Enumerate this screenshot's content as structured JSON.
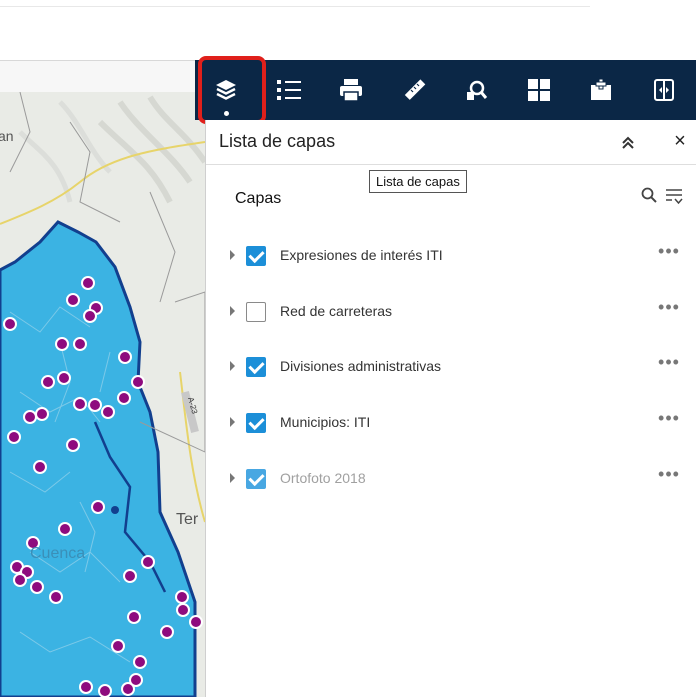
{
  "toolbar": {
    "tools": [
      {
        "icon": "layers-icon",
        "tooltip": "Lista de capas",
        "active": true
      },
      {
        "icon": "legend-icon"
      },
      {
        "icon": "print-icon"
      },
      {
        "icon": "measure-icon"
      },
      {
        "icon": "query-icon"
      },
      {
        "icon": "basemap-gallery-icon"
      },
      {
        "icon": "add-data-icon"
      },
      {
        "icon": "swipe-icon"
      }
    ],
    "bg_color": "#0b2746",
    "highlight_color": "#e0201b"
  },
  "panel": {
    "title": "Lista de capas",
    "tooltip": "Lista de capas",
    "section_title": "Capas",
    "layers": [
      {
        "label": "Expresiones de interés ITI",
        "checked": true
      },
      {
        "label": "Red de carreteras",
        "checked": false
      },
      {
        "label": "Divisiones administrativas",
        "checked": true
      },
      {
        "label": "Municipios: ITI",
        "checked": true
      },
      {
        "label": "Ortofoto 2018",
        "checked": true,
        "dimmed": true
      }
    ],
    "more_symbol": "•••",
    "close_symbol": "×",
    "checkbox_color": "#1c8fd8"
  },
  "map": {
    "labels": {
      "top_left": "an",
      "city": "Cuenca",
      "town": "Ter",
      "road": "A-23"
    },
    "region_color": "#3bb3e3",
    "boundary_color": "#123f8e",
    "point_color": "#8e0b7e"
  }
}
